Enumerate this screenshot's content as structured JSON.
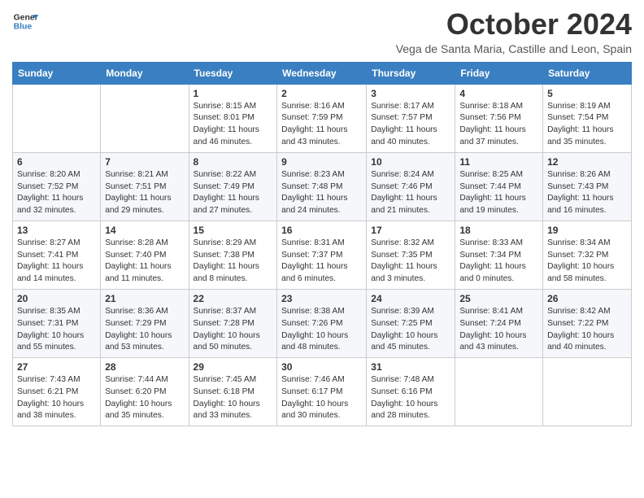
{
  "header": {
    "logo_line1": "General",
    "logo_line2": "Blue",
    "month_title": "October 2024",
    "location": "Vega de Santa Maria, Castille and Leon, Spain"
  },
  "days_of_week": [
    "Sunday",
    "Monday",
    "Tuesday",
    "Wednesday",
    "Thursday",
    "Friday",
    "Saturday"
  ],
  "weeks": [
    [
      {
        "day": "",
        "info": ""
      },
      {
        "day": "",
        "info": ""
      },
      {
        "day": "1",
        "info": "Sunrise: 8:15 AM\nSunset: 8:01 PM\nDaylight: 11 hours and 46 minutes."
      },
      {
        "day": "2",
        "info": "Sunrise: 8:16 AM\nSunset: 7:59 PM\nDaylight: 11 hours and 43 minutes."
      },
      {
        "day": "3",
        "info": "Sunrise: 8:17 AM\nSunset: 7:57 PM\nDaylight: 11 hours and 40 minutes."
      },
      {
        "day": "4",
        "info": "Sunrise: 8:18 AM\nSunset: 7:56 PM\nDaylight: 11 hours and 37 minutes."
      },
      {
        "day": "5",
        "info": "Sunrise: 8:19 AM\nSunset: 7:54 PM\nDaylight: 11 hours and 35 minutes."
      }
    ],
    [
      {
        "day": "6",
        "info": "Sunrise: 8:20 AM\nSunset: 7:52 PM\nDaylight: 11 hours and 32 minutes."
      },
      {
        "day": "7",
        "info": "Sunrise: 8:21 AM\nSunset: 7:51 PM\nDaylight: 11 hours and 29 minutes."
      },
      {
        "day": "8",
        "info": "Sunrise: 8:22 AM\nSunset: 7:49 PM\nDaylight: 11 hours and 27 minutes."
      },
      {
        "day": "9",
        "info": "Sunrise: 8:23 AM\nSunset: 7:48 PM\nDaylight: 11 hours and 24 minutes."
      },
      {
        "day": "10",
        "info": "Sunrise: 8:24 AM\nSunset: 7:46 PM\nDaylight: 11 hours and 21 minutes."
      },
      {
        "day": "11",
        "info": "Sunrise: 8:25 AM\nSunset: 7:44 PM\nDaylight: 11 hours and 19 minutes."
      },
      {
        "day": "12",
        "info": "Sunrise: 8:26 AM\nSunset: 7:43 PM\nDaylight: 11 hours and 16 minutes."
      }
    ],
    [
      {
        "day": "13",
        "info": "Sunrise: 8:27 AM\nSunset: 7:41 PM\nDaylight: 11 hours and 14 minutes."
      },
      {
        "day": "14",
        "info": "Sunrise: 8:28 AM\nSunset: 7:40 PM\nDaylight: 11 hours and 11 minutes."
      },
      {
        "day": "15",
        "info": "Sunrise: 8:29 AM\nSunset: 7:38 PM\nDaylight: 11 hours and 8 minutes."
      },
      {
        "day": "16",
        "info": "Sunrise: 8:31 AM\nSunset: 7:37 PM\nDaylight: 11 hours and 6 minutes."
      },
      {
        "day": "17",
        "info": "Sunrise: 8:32 AM\nSunset: 7:35 PM\nDaylight: 11 hours and 3 minutes."
      },
      {
        "day": "18",
        "info": "Sunrise: 8:33 AM\nSunset: 7:34 PM\nDaylight: 11 hours and 0 minutes."
      },
      {
        "day": "19",
        "info": "Sunrise: 8:34 AM\nSunset: 7:32 PM\nDaylight: 10 hours and 58 minutes."
      }
    ],
    [
      {
        "day": "20",
        "info": "Sunrise: 8:35 AM\nSunset: 7:31 PM\nDaylight: 10 hours and 55 minutes."
      },
      {
        "day": "21",
        "info": "Sunrise: 8:36 AM\nSunset: 7:29 PM\nDaylight: 10 hours and 53 minutes."
      },
      {
        "day": "22",
        "info": "Sunrise: 8:37 AM\nSunset: 7:28 PM\nDaylight: 10 hours and 50 minutes."
      },
      {
        "day": "23",
        "info": "Sunrise: 8:38 AM\nSunset: 7:26 PM\nDaylight: 10 hours and 48 minutes."
      },
      {
        "day": "24",
        "info": "Sunrise: 8:39 AM\nSunset: 7:25 PM\nDaylight: 10 hours and 45 minutes."
      },
      {
        "day": "25",
        "info": "Sunrise: 8:41 AM\nSunset: 7:24 PM\nDaylight: 10 hours and 43 minutes."
      },
      {
        "day": "26",
        "info": "Sunrise: 8:42 AM\nSunset: 7:22 PM\nDaylight: 10 hours and 40 minutes."
      }
    ],
    [
      {
        "day": "27",
        "info": "Sunrise: 7:43 AM\nSunset: 6:21 PM\nDaylight: 10 hours and 38 minutes."
      },
      {
        "day": "28",
        "info": "Sunrise: 7:44 AM\nSunset: 6:20 PM\nDaylight: 10 hours and 35 minutes."
      },
      {
        "day": "29",
        "info": "Sunrise: 7:45 AM\nSunset: 6:18 PM\nDaylight: 10 hours and 33 minutes."
      },
      {
        "day": "30",
        "info": "Sunrise: 7:46 AM\nSunset: 6:17 PM\nDaylight: 10 hours and 30 minutes."
      },
      {
        "day": "31",
        "info": "Sunrise: 7:48 AM\nSunset: 6:16 PM\nDaylight: 10 hours and 28 minutes."
      },
      {
        "day": "",
        "info": ""
      },
      {
        "day": "",
        "info": ""
      }
    ]
  ]
}
